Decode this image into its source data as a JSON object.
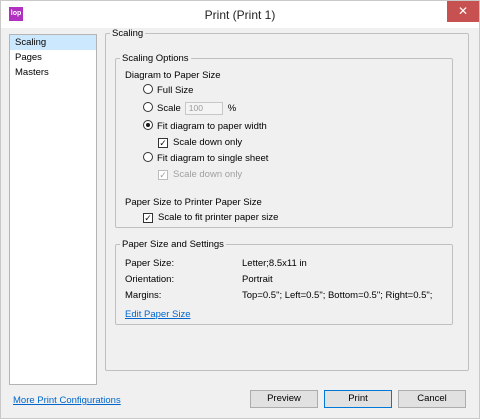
{
  "window": {
    "title": "Print (Print 1)",
    "app_icon_text": "lop",
    "close_glyph": "✕"
  },
  "sidebar": {
    "items": [
      {
        "label": "Scaling",
        "selected": true
      },
      {
        "label": "Pages",
        "selected": false
      },
      {
        "label": "Masters",
        "selected": false
      }
    ]
  },
  "scaling": {
    "group_title": "Scaling",
    "options_title": "Scaling Options",
    "diagram_to_paper_label": "Diagram to Paper Size",
    "full_size_label": "Full Size",
    "scale_label": "Scale",
    "scale_value": "100",
    "scale_unit": "%",
    "fit_width_label": "Fit diagram to paper width",
    "scale_down_only_label": "Scale down only",
    "fit_single_sheet_label": "Fit diagram to single sheet",
    "scale_down_only_disabled_label": "Scale down only",
    "paper_to_printer_label": "Paper Size to Printer Paper Size",
    "scale_to_fit_label": "Scale to fit printer paper size",
    "check_glyph": "✓"
  },
  "paper": {
    "group_title": "Paper Size and Settings",
    "size_label": "Paper Size:",
    "size_value": "Letter;8.5x11 in",
    "orientation_label": "Orientation:",
    "orientation_value": "Portrait",
    "margins_label": "Margins:",
    "margins_value": "Top=0.5\"; Left=0.5\"; Bottom=0.5\"; Right=0.5\";",
    "edit_link": "Edit Paper Size"
  },
  "footer": {
    "more_link": "More Print Configurations",
    "preview_label": "Preview",
    "print_label": "Print",
    "cancel_label": "Cancel"
  }
}
